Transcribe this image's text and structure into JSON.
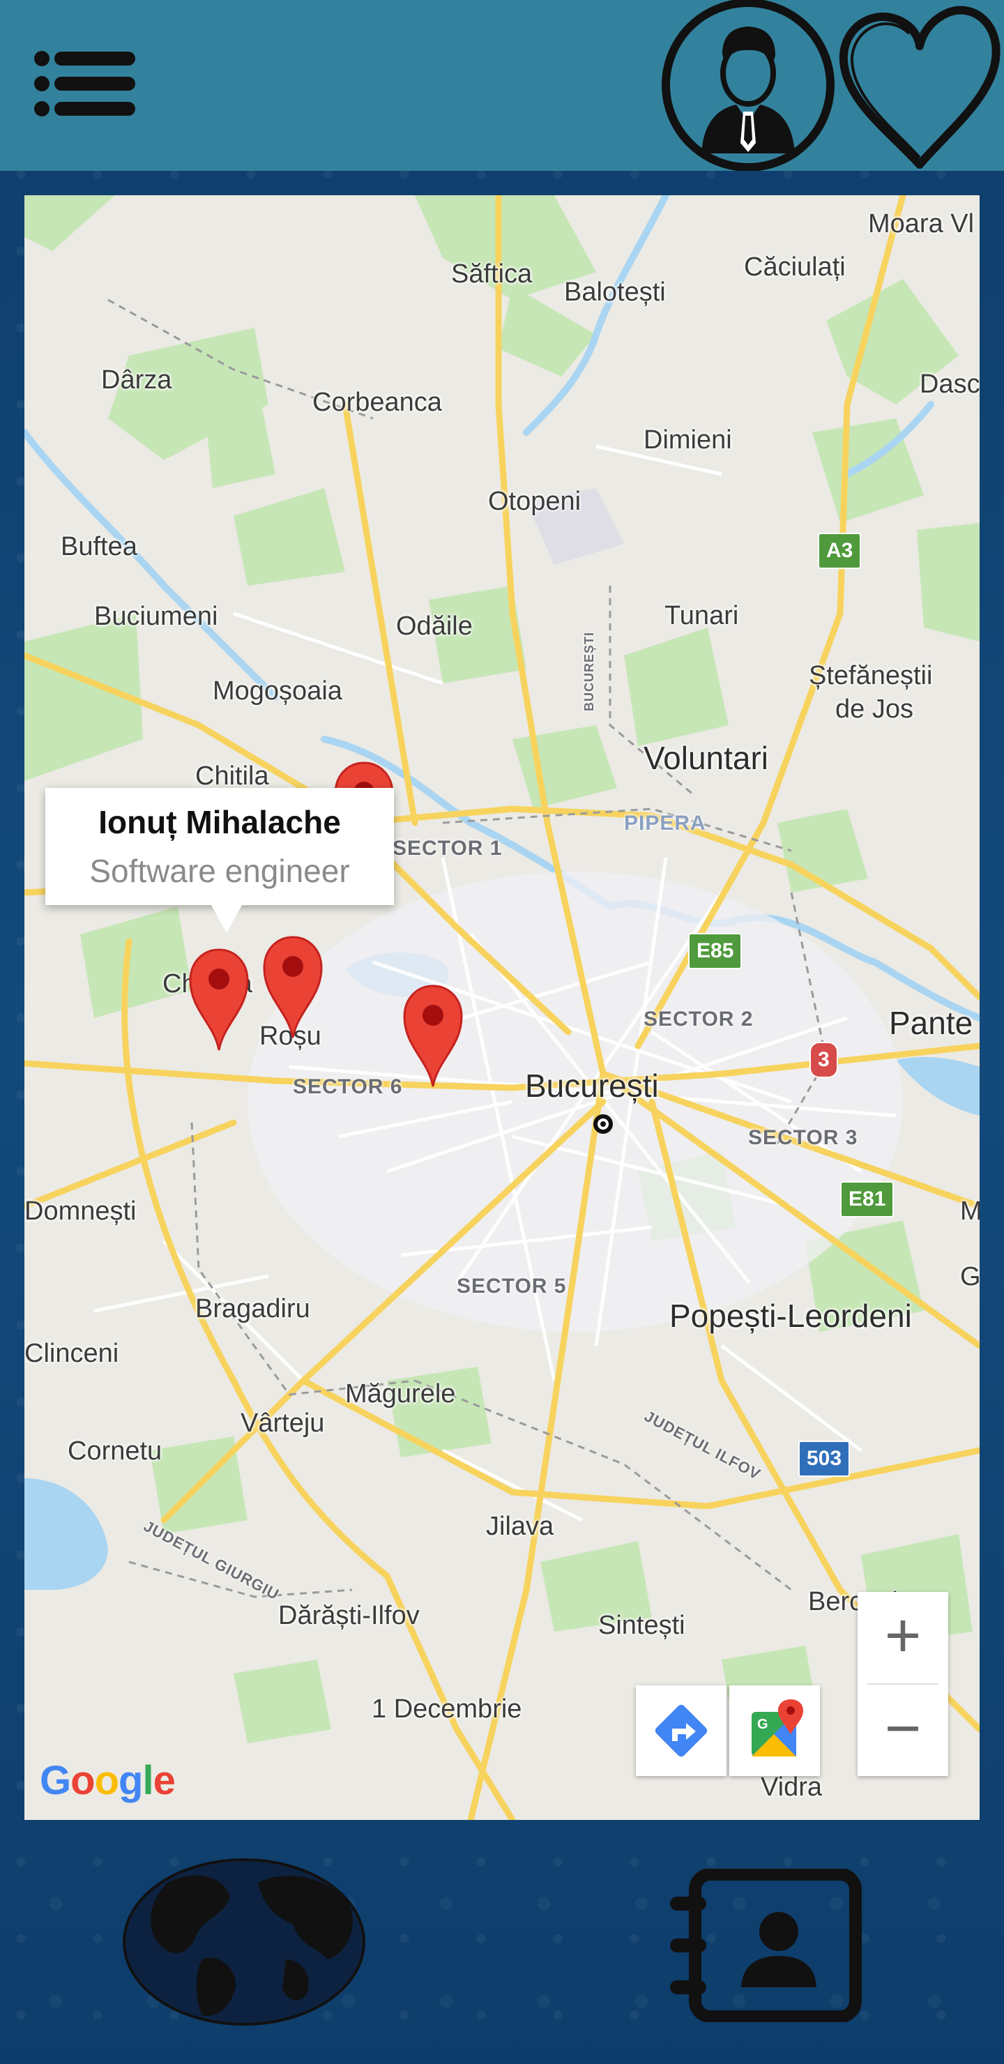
{
  "colors": {
    "topbar": "#33829d",
    "background": "#0f3f6d",
    "marker": "#ea4335",
    "map_land": "#eceae4",
    "map_green": "#c6e6b6",
    "map_water": "#a9d5f2",
    "major_road": "#f7d35e"
  },
  "header": {
    "menu_icon": "menu-lines-icon",
    "profile_icon": "businessman-avatar-icon",
    "favorites_icon": "heart-outline-icon"
  },
  "map": {
    "places": {
      "moara": "Moara Vl",
      "saftica": "Săftica",
      "caciulati": "Căciulați",
      "balotesti": "Balotești",
      "darza": "Dârza",
      "corbeanca": "Corbeanca",
      "dasc": "Dasc",
      "dimieni": "Dimieni",
      "otopeni": "Otopeni",
      "buftea": "Buftea",
      "buciumeni": "Buciumeni",
      "odaile": "Odăile",
      "tunari": "Tunari",
      "stefanestii": "Ștefăneștii",
      "de_jos": "de Jos",
      "mogosoaia": "Mogoșoaia",
      "voluntari": "Voluntari",
      "chitila": "Chitila",
      "chiajna": "Chiajna",
      "rosu": "Roșu",
      "pante": "Pante",
      "bucuresti": "București",
      "domnesti": "Domnești",
      "bragadiru": "Bragadiru",
      "popesti": "Popești-Leordeni",
      "clinceni": "Clinceni",
      "magurele": "Măgurele",
      "varteju": "Vârteju",
      "cornetu": "Cornetu",
      "jilava": "Jilava",
      "berceni": "Berceni",
      "darasti": "Dărăști-Ilfov",
      "sintesti": "Sintești",
      "decembrie": "1 Decembrie",
      "vidra": "Vidra",
      "m_edge": "M",
      "g_edge": "G"
    },
    "sectors": {
      "s1": "SECTOR 1",
      "s2": "SECTOR 2",
      "s3": "SECTOR 3",
      "s5": "SECTOR 5",
      "s6": "SECTOR 6",
      "pipera": "PIPERA",
      "bucuresti_road": "BUCUREȘTI",
      "judetul_ilfov": "JUDEȚUL ILFOV",
      "judetul_giurgiu": "JUDEȚUL GIURGIU"
    },
    "shields": {
      "a3": "A3",
      "e85": "E85",
      "r3": "3",
      "e81": "E81",
      "r503": "503"
    },
    "info_window": {
      "name": "Ionuț Mihalache",
      "title": "Software engineer"
    },
    "google_logo": [
      "G",
      "o",
      "o",
      "g",
      "l",
      "e"
    ],
    "controls": {
      "zoom_in": "+",
      "zoom_out": "−",
      "directions_icon": "directions-icon",
      "maps_icon": "google-maps-icon"
    }
  },
  "bottom_nav": {
    "globe_icon": "globe-icon",
    "contacts_icon": "address-book-icon"
  }
}
